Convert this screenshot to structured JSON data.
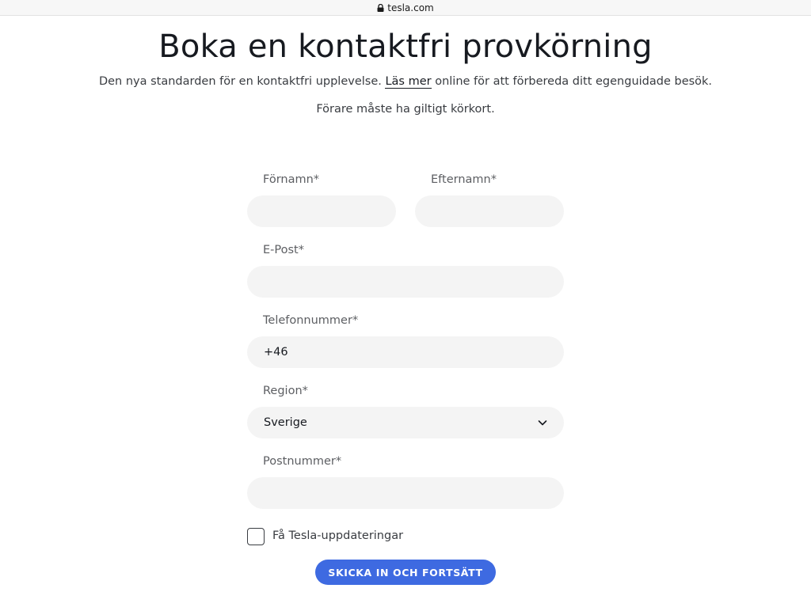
{
  "browser": {
    "url": "tesla.com",
    "lock_icon": "lock-icon"
  },
  "page": {
    "title": "Boka en kontaktfri provkörning",
    "subtitle_before": "Den nya standarden för en kontaktfri upplevelse. ",
    "subtitle_link": "Läs mer",
    "subtitle_after": " online för att förbereda ditt egenguidade besök.",
    "note": "Förare måste ha giltigt körkort."
  },
  "form": {
    "first_name": {
      "label": "Förnamn*",
      "value": ""
    },
    "last_name": {
      "label": "Efternamn*",
      "value": ""
    },
    "email": {
      "label": "E-Post*",
      "value": ""
    },
    "phone": {
      "label": "Telefonnummer*",
      "value": "+46"
    },
    "region": {
      "label": "Region*",
      "value": "Sverige",
      "icon": "chevron-down-icon"
    },
    "postal_code": {
      "label": "Postnummer*",
      "value": ""
    },
    "updates_checkbox": {
      "label": "Få Tesla-uppdateringar",
      "checked": false
    },
    "submit_label": "SKICKA IN OCH FORTSÄTT"
  },
  "colors": {
    "accent": "#3e6ae1",
    "field_bg": "#f4f4f4",
    "text": "#171a20"
  }
}
